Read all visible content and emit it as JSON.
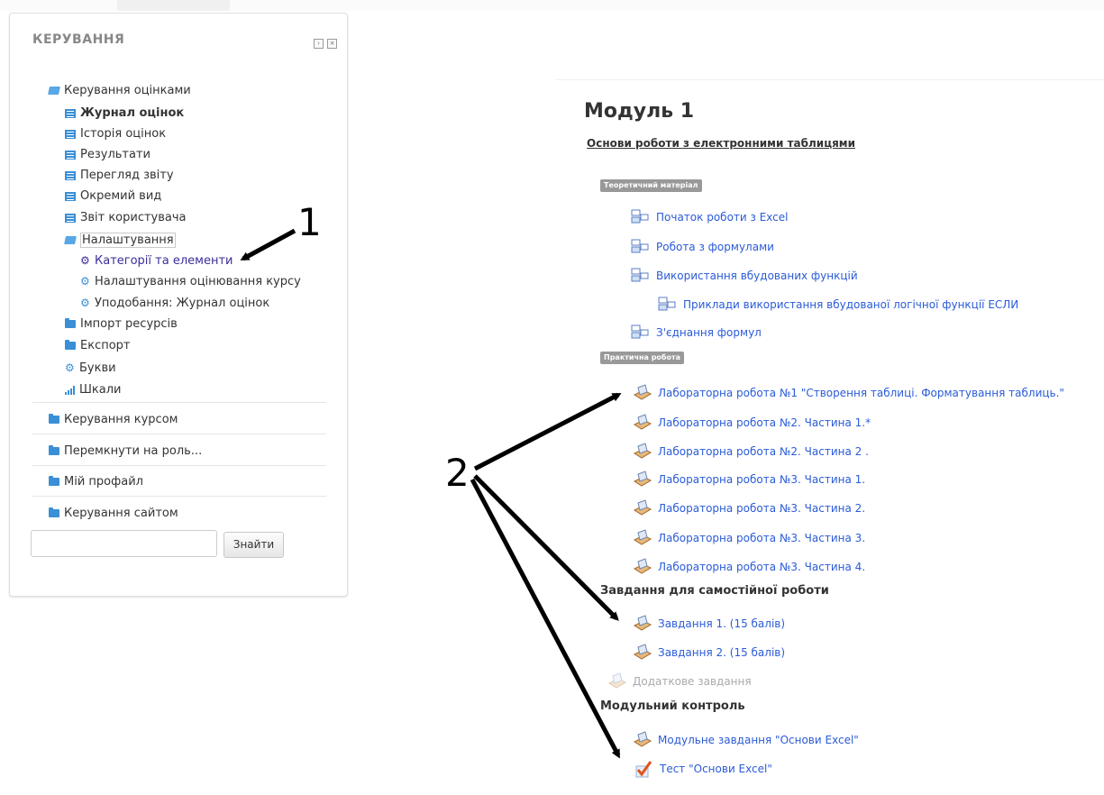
{
  "block": {
    "title": "КЕРУВАННЯ",
    "tree": [
      {
        "label": "Керування оцінками",
        "icon": "folder-open-icon",
        "bold": false
      },
      {
        "label": "Журнал оцінок",
        "icon": "report-icon",
        "bold": true
      },
      {
        "label": "Історія оцінок",
        "icon": "report-icon"
      },
      {
        "label": "Результати",
        "icon": "report-icon"
      },
      {
        "label": "Перегляд звіту",
        "icon": "report-icon"
      },
      {
        "label": "Окремий вид",
        "icon": "report-icon"
      },
      {
        "label": "Звіт користувача",
        "icon": "report-icon"
      },
      {
        "label": "Налаштування",
        "icon": "folder-open-icon"
      },
      {
        "label": "Категорії та елементи",
        "icon": "gear-icon",
        "active": true
      },
      {
        "label": "Налаштування оцінювання курсу",
        "icon": "gear-icon"
      },
      {
        "label": "Уподобання: Журнал оцінок",
        "icon": "gear-icon"
      },
      {
        "label": "Імпорт ресурсів",
        "icon": "folder-icon"
      },
      {
        "label": "Експорт",
        "icon": "folder-icon"
      },
      {
        "label": "Букви",
        "icon": "gear-icon"
      },
      {
        "label": "Шкали",
        "icon": "scale-icon"
      }
    ],
    "sections": [
      {
        "label": "Керування курсом"
      },
      {
        "label": "Перемкнути на роль..."
      },
      {
        "label": "Мій профайл"
      },
      {
        "label": "Керування сайтом"
      }
    ],
    "search_button": "Знайти"
  },
  "module": {
    "title": "Модуль 1",
    "subtitle": "Основи роботи з електронними таблицями",
    "label_theory": "Теоретичний матеріал",
    "label_practice": "Практична робота",
    "theory": [
      {
        "label": "Початок роботи з Excel"
      },
      {
        "label": "Робота з формулами"
      },
      {
        "label": "Використання вбудованих функцій"
      },
      {
        "label": "Приклади використання вбудованої логічної функції ЕСЛИ"
      },
      {
        "label": "З'єднання формул"
      }
    ],
    "practice": [
      {
        "label": "Лабораторна робота №1 \"Створення таблиці. Форматування таблиць.\""
      },
      {
        "label": "Лабораторна робота №2. Частина 1.*"
      },
      {
        "label": "Лабораторна робота №2. Частина 2 ."
      },
      {
        "label": "Лабораторна робота №3. Частина 1."
      },
      {
        "label": "Лабораторна робота №3. Частина 2."
      },
      {
        "label": "Лабораторна робота №3. Частина 3."
      },
      {
        "label": "Лабораторна робота №3. Частина 4."
      }
    ],
    "self_heading": "Завдання для самостійної роботи",
    "self": [
      {
        "label": "Завдання 1. (15 балів)"
      },
      {
        "label": "Завдання 2. (15 балів)"
      }
    ],
    "extra": "Додаткове завдання",
    "control_heading": "Модульний контроль",
    "control": [
      {
        "label": "Модульне завдання \"Основи Excel\""
      },
      {
        "label": "Тест \"Основи Excel\""
      }
    ]
  },
  "annotations": {
    "one": "1",
    "two": "2"
  },
  "colors": {
    "link": "#2a5bd7",
    "icon_blue": "#3a8fd6",
    "active": "#3a2d9c"
  }
}
